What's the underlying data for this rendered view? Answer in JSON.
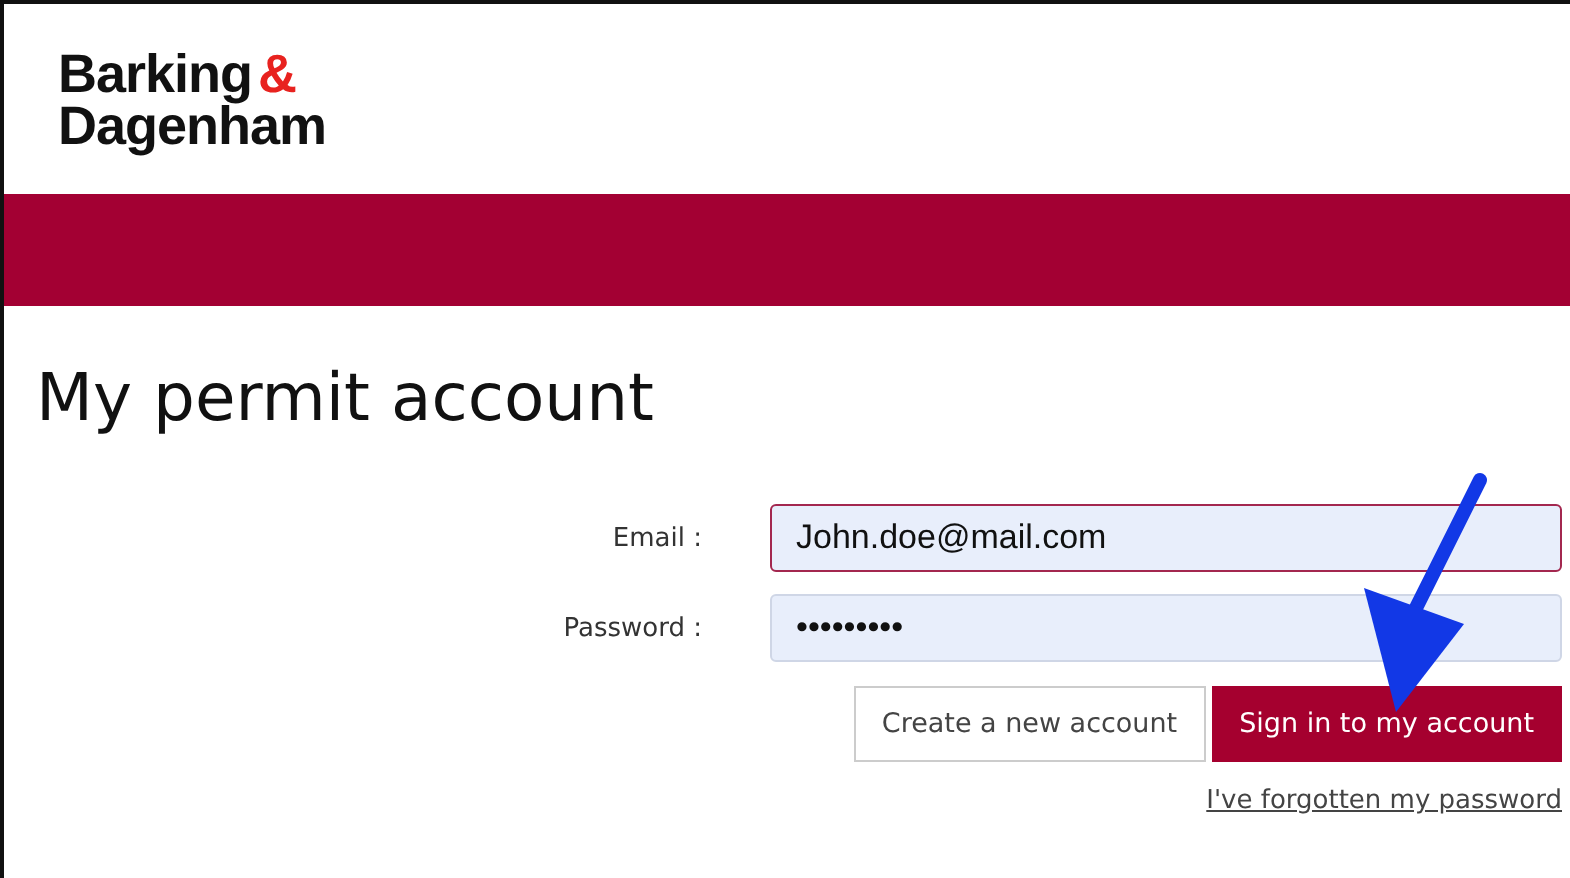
{
  "logo": {
    "line_1": "Barking",
    "ampersand": "&",
    "line_2": "Dagenham"
  },
  "title": "My permit account",
  "form": {
    "fields": [
      {
        "label": "Email :",
        "value": "John.doe@mail.com",
        "focused": true
      },
      {
        "label": "Password :",
        "value": "•••••••••",
        "focused": false
      }
    ],
    "buttons": [
      {
        "label": "Create a new account",
        "kind": "secondary"
      },
      {
        "label": "Sign in to my account",
        "kind": "primary"
      }
    ],
    "link": "I've forgotten my password"
  }
}
